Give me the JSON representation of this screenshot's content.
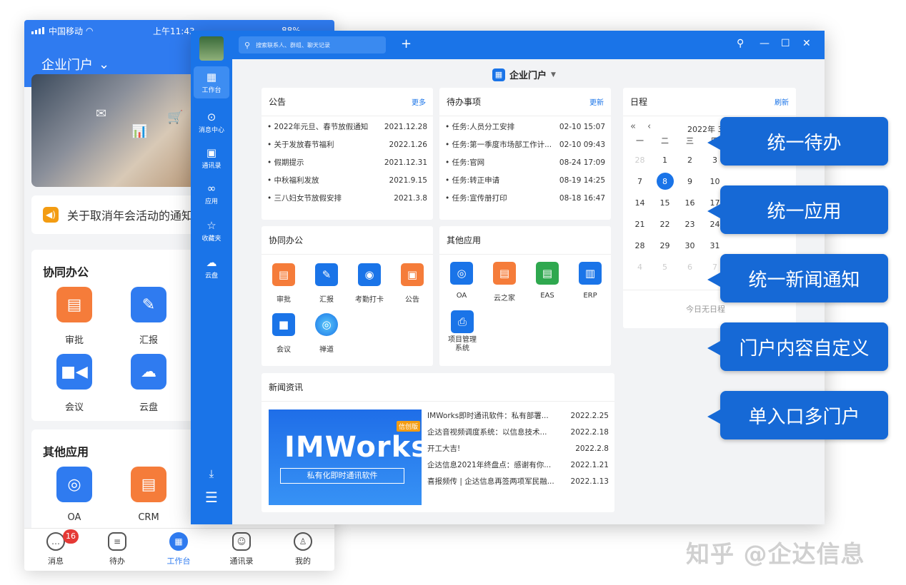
{
  "phone": {
    "carrier": "中国移动",
    "time": "上午11:43",
    "battery": "88%",
    "header_title": "企业门户",
    "notice": "关于取消年会活动的通知",
    "cowork_title": "协同办公",
    "cowork_apps": [
      "审批",
      "汇报",
      "会议",
      "云盘"
    ],
    "other_title": "其他应用",
    "other_apps": [
      "OA",
      "CRM"
    ],
    "tabs": [
      "消息",
      "待办",
      "工作台",
      "通讯录",
      "我的"
    ],
    "msg_badge": "16"
  },
  "desktop": {
    "search_placeholder": "搜索联系人、群组、聊天记录",
    "sidebar": [
      "工作台",
      "消息中心",
      "通讯录",
      "应用",
      "收藏夹",
      "云盘"
    ],
    "portal_title": "企业门户",
    "announce": {
      "title": "公告",
      "more": "更多",
      "items": [
        {
          "text": "• 2022年元旦、春节放假通知",
          "date": "2021.12.28"
        },
        {
          "text": "• 关于发放春节福利",
          "date": "2022.1.26"
        },
        {
          "text": "• 假期提示",
          "date": "2021.12.31"
        },
        {
          "text": "• 中秋福利发放",
          "date": "2021.9.15"
        },
        {
          "text": "• 三八妇女节放假安排",
          "date": "2021.3.8"
        }
      ]
    },
    "todo": {
      "title": "待办事项",
      "more": "更新",
      "items": [
        {
          "text": "• 任务:人员分工安排",
          "date": "02-10 15:07"
        },
        {
          "text": "• 任务:第一季度市场部工作计...",
          "date": "02-10 09:43"
        },
        {
          "text": "• 任务:官网",
          "date": "08-24 17:09"
        },
        {
          "text": "• 任务:转正申请",
          "date": "08-19 14:25"
        },
        {
          "text": "• 任务:宣传册打印",
          "date": "08-18 16:47"
        }
      ]
    },
    "schedule": {
      "title": "日程",
      "refresh": "刷新",
      "nav_prev2": "«",
      "nav_prev": "‹",
      "month": "2022年 3",
      "weekdays": [
        "一",
        "二",
        "三",
        "四"
      ],
      "weeks": [
        [
          "28",
          "1",
          "2",
          "3"
        ],
        [
          "7",
          "8",
          "9",
          "10"
        ],
        [
          "14",
          "15",
          "16",
          "17"
        ],
        [
          "21",
          "22",
          "23",
          "24"
        ],
        [
          "28",
          "29",
          "30",
          "31"
        ],
        [
          "4",
          "5",
          "6",
          "7"
        ]
      ],
      "today": "8",
      "empty": "今日无日程"
    },
    "cowork": {
      "title": "协同办公",
      "apps": [
        "审批",
        "汇报",
        "考勤打卡",
        "公告",
        "会议",
        "禅道"
      ]
    },
    "other": {
      "title": "其他应用",
      "apps": [
        "OA",
        "云之家",
        "EAS",
        "ERP",
        "项目管理系统"
      ]
    },
    "news": {
      "title": "新闻资讯",
      "banner_big": "IMWorks",
      "banner_sub": "私有化即时通讯软件",
      "banner_tag": "信创版",
      "items": [
        {
          "text": "IMWorks即时通讯软件：私有部署...",
          "date": "2022.2.25"
        },
        {
          "text": "企达音视频调度系统：以信息技术...",
          "date": "2022.2.18"
        },
        {
          "text": "开工大吉!",
          "date": "2022.2.8"
        },
        {
          "text": "企达信息2021年终盘点：感谢有你...",
          "date": "2022.1.21"
        },
        {
          "text": "喜报频传 | 企达信息再签两项军民融...",
          "date": "2022.1.13"
        }
      ]
    }
  },
  "callouts": [
    "统一待办",
    "统一应用",
    "统一新闻通知",
    "门户内容自定义",
    "单入口多门户"
  ],
  "watermark": "知乎 @企达信息",
  "colors": {
    "brand": "#1a74e8",
    "callout": "#1669d6"
  }
}
